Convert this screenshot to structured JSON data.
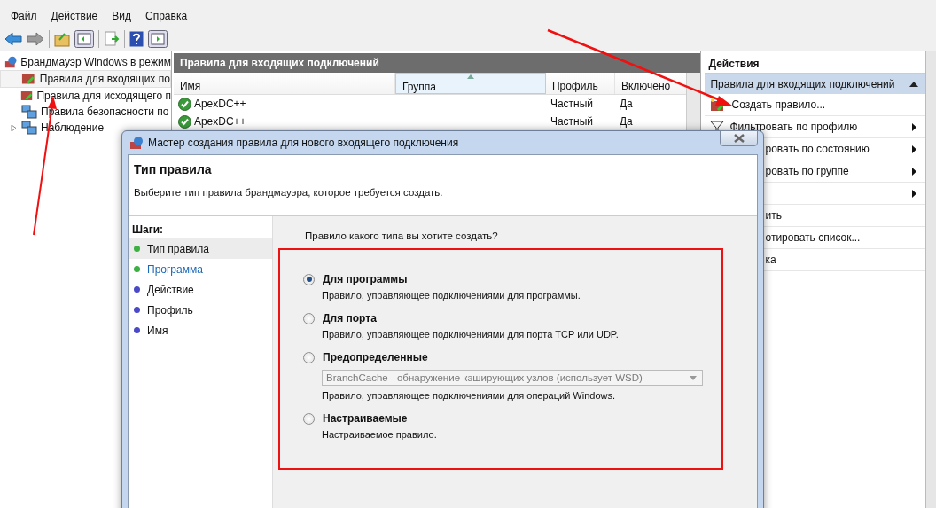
{
  "menu": [
    "Файл",
    "Действие",
    "Вид",
    "Справка"
  ],
  "tree": [
    {
      "label": "Брандмауэр Windows в режим",
      "selected": false,
      "children": [
        {
          "label": "Правила для входящих по",
          "selected": true,
          "expandable": false
        },
        {
          "label": "Правила для исходящего п",
          "selected": false,
          "expandable": false
        },
        {
          "label": "Правила безопасности по",
          "selected": false,
          "expandable": false
        },
        {
          "label": "Наблюдение",
          "selected": false,
          "expandable": true
        }
      ]
    }
  ],
  "rules_pane": {
    "title": "Правила для входящих подключений",
    "columns": [
      {
        "label": "Имя",
        "sorted": false
      },
      {
        "label": "Группа",
        "sorted": true
      },
      {
        "label": "Профиль",
        "sorted": false
      },
      {
        "label": "Включено",
        "sorted": false
      }
    ],
    "rows": [
      {
        "name": "ApexDC++",
        "profile": "Частный",
        "enabled": "Да"
      },
      {
        "name": "ApexDC++",
        "profile": "Частный",
        "enabled": "Да"
      }
    ]
  },
  "actions": {
    "title": "Действия",
    "section": {
      "label": "Правила для входящих подключений",
      "expanded": true
    },
    "items": [
      {
        "label": "Создать правило...",
        "kind": "new-rule",
        "submenu": false,
        "partial": false
      },
      {
        "label": "Фильтровать по профилю",
        "kind": "filter",
        "submenu": true,
        "partial": false
      },
      {
        "label": "ровать по состоянию",
        "kind": "plain",
        "submenu": true,
        "partial": true
      },
      {
        "label": "ровать по группе",
        "kind": "plain",
        "submenu": true,
        "partial": true
      },
      {
        "kind": "plain",
        "submenu": true,
        "partial": true
      },
      {
        "label": "ить",
        "kind": "plain",
        "submenu": false,
        "partial": true
      },
      {
        "label": "отировать список...",
        "kind": "plain",
        "submenu": false,
        "partial": true
      },
      {
        "label": "ка",
        "kind": "plain",
        "submenu": false,
        "partial": true
      }
    ]
  },
  "dialog": {
    "title": "Мастер создания правила для нового входящего подключения",
    "heading": "Тип правила",
    "subtitle": "Выберите тип правила брандмауэра, которое требуется создать.",
    "steps_label": "Шаги:",
    "steps": [
      {
        "label": "Тип правила",
        "selected": true,
        "link": false,
        "color": "#3cb043"
      },
      {
        "label": "Программа",
        "selected": false,
        "link": true,
        "color": "#3cb043"
      },
      {
        "label": "Действие",
        "selected": false,
        "link": false,
        "color": "#4a4ac8"
      },
      {
        "label": "Профиль",
        "selected": false,
        "link": false,
        "color": "#4a4ac8"
      },
      {
        "label": "Имя",
        "selected": false,
        "link": false,
        "color": "#4a4ac8"
      }
    ],
    "question": "Правило какого типа вы хотите создать?",
    "options": [
      {
        "label": "Для программы",
        "description": "Правило, управляющее подключениями для программы.",
        "selected": true
      },
      {
        "label": "Для порта",
        "description": "Правило, управляющее подключениями для порта TCP или UDP.",
        "selected": false
      },
      {
        "label": "Предопределенные",
        "description": "Правило, управляющее подключениями для операций Windows.",
        "selected": false,
        "dropdown": {
          "value": "BranchCache - обнаружение кэширующих узлов (использует WSD)",
          "disabled": true
        }
      },
      {
        "label": "Настраиваемые",
        "description": "Настраиваемое правило.",
        "selected": false
      }
    ]
  }
}
